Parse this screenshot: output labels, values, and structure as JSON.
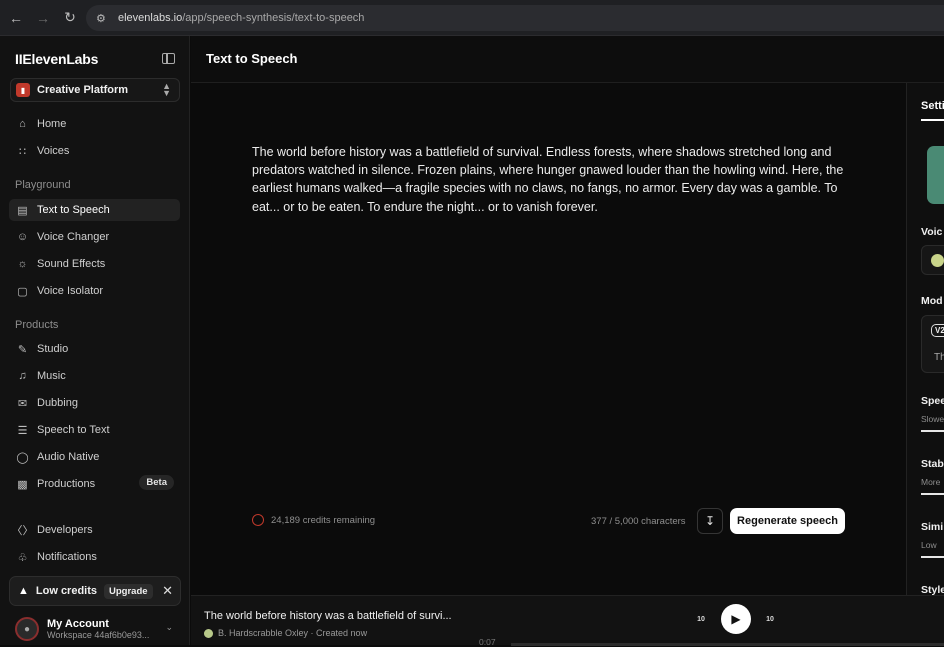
{
  "browser": {
    "url_domain": "elevenlabs.io",
    "url_path": "/app/speech-synthesis/text-to-speech"
  },
  "sidebar": {
    "brand": "IIElevenLabs",
    "platform": "Creative Platform",
    "home": "Home",
    "voices": "Voices",
    "playground_label": "Playground",
    "playground": [
      "Text to Speech",
      "Voice Changer",
      "Sound Effects",
      "Voice Isolator"
    ],
    "products_label": "Products",
    "products": [
      "Studio",
      "Music",
      "Dubbing",
      "Speech to Text",
      "Audio Native",
      "Productions"
    ],
    "productions_badge": "Beta",
    "developers": "Developers",
    "notifications": "Notifications",
    "low_credits": "Low credits",
    "upgrade": "Upgrade",
    "account_name": "My Account",
    "account_workspace": "Workspace 44af6b0e93..."
  },
  "main": {
    "title": "Text to Speech",
    "text": "The world before history was a battlefield of survival. Endless forests, where shadows stretched long and predators watched in silence. Frozen plains, where hunger gnawed louder than the howling wind. Here, the earliest humans walked—a fragile species with no claws, no fangs, no armor. Every day was a gamble. To eat... or to be eaten. To endure the night... or to vanish forever.",
    "credits": "24,189 credits remaining",
    "char_count": "377 / 5,000 characters",
    "regenerate": "Regenerate speech"
  },
  "right_panel": {
    "tab": "Setti",
    "voice_label": "Voic",
    "model_label": "Mod",
    "model_badge": "V2",
    "model_text": "Th",
    "speed_label": "Spee",
    "speed_sub": "Slowe",
    "stability_label": "Stab",
    "stability_sub": "More",
    "similarity_label": "Simi",
    "similarity_sub": "Low",
    "style_label": "Style"
  },
  "player": {
    "title": "The world before history was a battlefield of survi...",
    "meta": "B. Hardscrabble Oxley · Created now",
    "time": "0:07",
    "skip_back": "10",
    "skip_fwd": "10"
  }
}
